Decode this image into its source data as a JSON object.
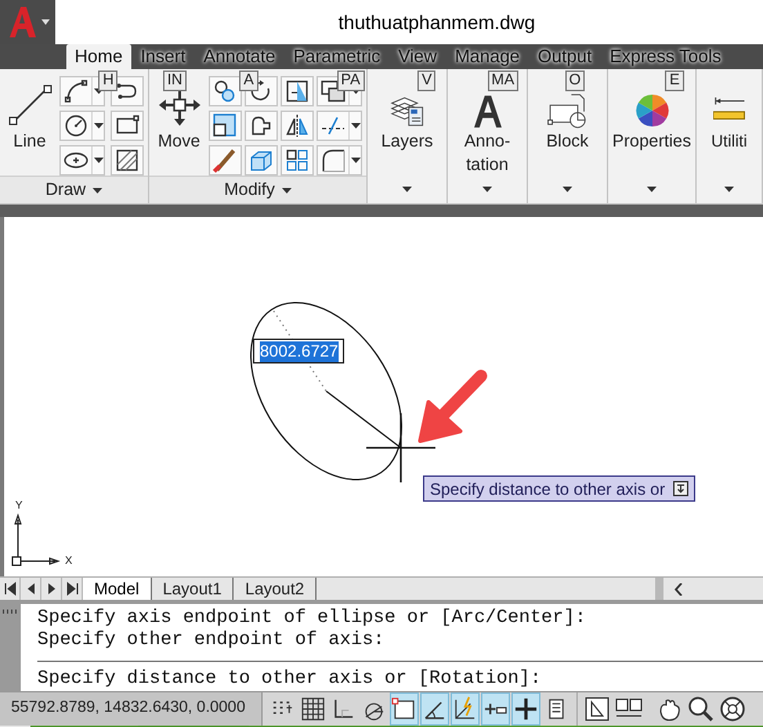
{
  "window": {
    "title": "thuthuatphanmem.dwg"
  },
  "ribbon_tabs": [
    {
      "label": "Home",
      "selected": true,
      "keytip": "H"
    },
    {
      "label": "Insert",
      "selected": false,
      "keytip": "IN"
    },
    {
      "label": "Annotate",
      "selected": false,
      "keytip": "A"
    },
    {
      "label": "Parametric",
      "selected": false,
      "keytip": "PA"
    },
    {
      "label": "View",
      "selected": false,
      "keytip": "V"
    },
    {
      "label": "Manage",
      "selected": false,
      "keytip": "MA"
    },
    {
      "label": "Output",
      "selected": false,
      "keytip": "O"
    },
    {
      "label": "Express Tools",
      "selected": false,
      "keytip": "E"
    }
  ],
  "panels": [
    {
      "kind": "draw",
      "title": "Draw",
      "label_lines": [
        "Line"
      ]
    },
    {
      "kind": "modify",
      "title": "Modify",
      "label_lines": [
        "Move"
      ]
    },
    {
      "kind": "layers",
      "label_lines": [
        "Layers"
      ]
    },
    {
      "kind": "annotation",
      "label_lines": [
        "Anno-",
        "tation"
      ]
    },
    {
      "kind": "block",
      "label_lines": [
        "Block"
      ]
    },
    {
      "kind": "properties",
      "label_lines": [
        "Properties"
      ]
    },
    {
      "kind": "utilities",
      "label_lines": [
        "Utiliti"
      ]
    }
  ],
  "drawing_area": {
    "dimension_input": "8002.6727",
    "tooltip": "Specify distance to other axis or",
    "ucs": {
      "y_label": "Y",
      "x_label": "X"
    }
  },
  "layout_tabs": [
    {
      "label": "Model",
      "selected": true
    },
    {
      "label": "Layout1",
      "selected": false
    },
    {
      "label": "Layout2",
      "selected": false
    }
  ],
  "command_history": [
    "Specify axis endpoint of ellipse or [Arc/Center]:",
    "Specify other endpoint of axis:"
  ],
  "command_prompt": "Specify distance to other axis or [Rotation]:",
  "status_bar": {
    "coordinates": "55792.8789, 14832.6430, 0.0000",
    "toggles": [
      {
        "on": false
      },
      {
        "on": false
      },
      {
        "on": false
      },
      {
        "on": false
      },
      {
        "on": true
      },
      {
        "on": true
      },
      {
        "on": true
      },
      {
        "on": true
      },
      {
        "on": true
      },
      {
        "on": false
      }
    ]
  }
}
